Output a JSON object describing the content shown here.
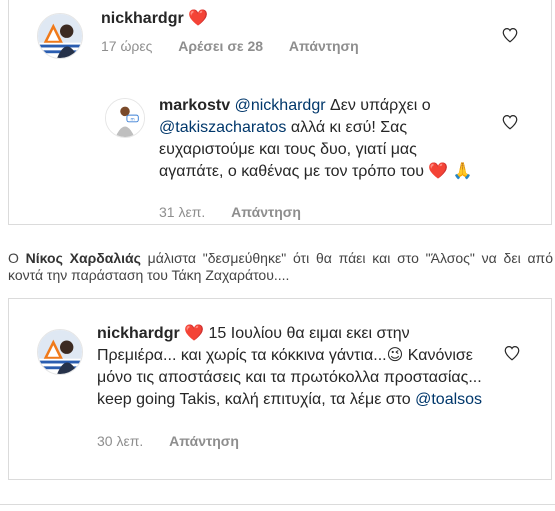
{
  "comment1": {
    "username": "nickhardgr",
    "text": "❤️",
    "time": "17 ώρες",
    "likes": "Αρέσει σε 28",
    "reply": "Απάντηση"
  },
  "reply1": {
    "username": "markostv",
    "mention1": "@nickhardgr",
    "text1": " Δεν υπάρχει ο ",
    "mention2": "@takiszacharatos",
    "text2": " αλλά κι εσύ! Σας ευχαριστούμε και τους δυο, γιατί μας αγαπάτε, ο καθένας με τον τρόπο του ❤️ 🙏",
    "time": "31 λεπ.",
    "reply": "Απάντηση"
  },
  "article": {
    "prefix": "Ο ",
    "name": "Νίκος Χαρδαλιάς",
    "text": " μάλιστα \"δεσμεύθηκε\" ότι θα πάει και στο \"Άλσος\" να δει από κοντά την παράσταση του Τάκη Ζαχαράτου...."
  },
  "comment2": {
    "username": "nickhardgr",
    "text1": " ❤️ 15 Ιουλίου θα ειμαι εκει στην Πρεμιέρα... και χωρίς τα κόκκινα γάντια...😉 Κανόνισε μόνο τις αποστάσεις και τα πρωτόκολλα προστασίας... keep going Takis, καλή επιτυχία, τα λέμε στο ",
    "mention": "@toalsos",
    "time": "30 λεπ.",
    "reply": "Απάντηση"
  },
  "colors": {
    "mention": "#00376b",
    "meta": "#8e8e8e",
    "border": "#dbdbdb",
    "heart": "#e0245e"
  },
  "icons": [
    "avatar-nickhardgr",
    "avatar-markostv",
    "heart-outline-icon"
  ]
}
